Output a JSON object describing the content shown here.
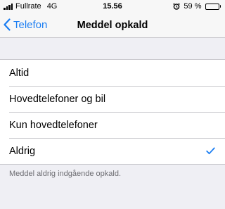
{
  "status_bar": {
    "carrier": "Fullrate",
    "network": "4G",
    "time": "15.56",
    "battery_percent_label": "59 %",
    "battery_level": 0.59,
    "icons": [
      "signal-icon",
      "alarm-icon",
      "battery-icon"
    ]
  },
  "nav": {
    "back_label": "Telefon",
    "title": "Meddel opkald",
    "accent_color": "#1a7df2"
  },
  "options": {
    "items": [
      {
        "label": "Altid",
        "selected": false
      },
      {
        "label": "Hovedtelefoner og bil",
        "selected": false
      },
      {
        "label": "Kun hovedtelefoner",
        "selected": false
      },
      {
        "label": "Aldrig",
        "selected": true
      }
    ]
  },
  "footer": {
    "text": "Meddel aldrig indgående opkald."
  }
}
